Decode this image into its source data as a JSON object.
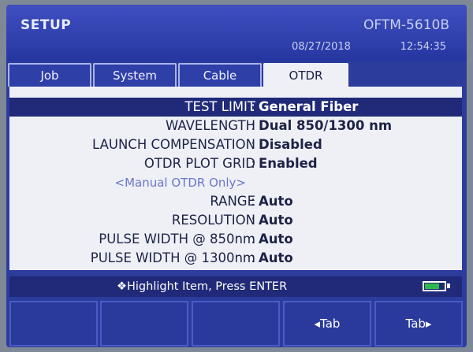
{
  "header": {
    "title": "SETUP",
    "model": "OFTM-5610B",
    "date": "08/27/2018",
    "time": "12:54:35"
  },
  "tabs": [
    {
      "label": "Job"
    },
    {
      "label": "System"
    },
    {
      "label": "Cable"
    },
    {
      "label": "OTDR",
      "active": true
    }
  ],
  "settings": [
    {
      "label": "TEST LIMIT",
      "value": "General Fiber"
    },
    {
      "label": "WAVELENGTH",
      "value": "Dual 850/1300 nm"
    },
    {
      "label": "LAUNCH COMPENSATION",
      "value": "Disabled"
    },
    {
      "label": "OTDR PLOT GRID",
      "value": "Enabled"
    },
    {
      "label": "RANGE",
      "value": "Auto"
    },
    {
      "label": "RESOLUTION",
      "value": "Auto"
    },
    {
      "label": "PULSE WIDTH @ 850nm",
      "value": "Auto"
    },
    {
      "label": "PULSE WIDTH @ 1300nm",
      "value": "Auto"
    }
  ],
  "separator": ":",
  "manual_note": "<Manual OTDR Only>",
  "status": {
    "text": "❖Highlight Item, Press ENTER",
    "battery_level": 0.75,
    "battery_color": "#2fb84f"
  },
  "softkeys": [
    {
      "label": ""
    },
    {
      "label": ""
    },
    {
      "label": ""
    },
    {
      "label": "◂Tab"
    },
    {
      "label": "Tab▸"
    }
  ]
}
